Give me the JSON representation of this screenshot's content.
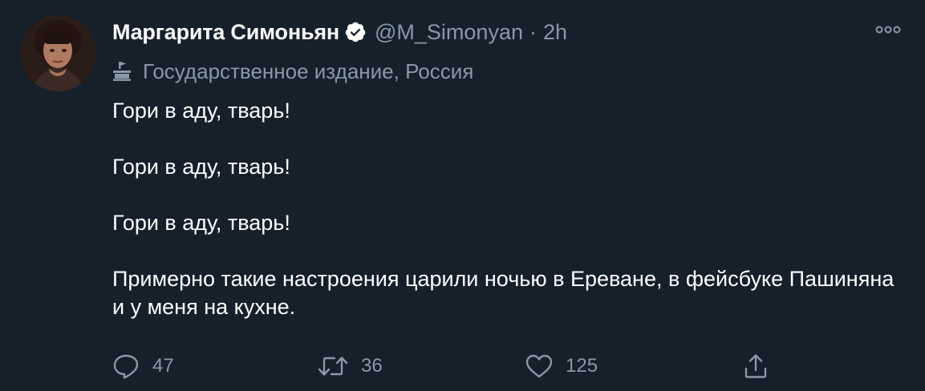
{
  "tweet": {
    "author_name": "Маргарита Симоньян",
    "handle": "@M_Simonyan",
    "separator": "·",
    "time": "2h",
    "state_media_label": "Государственное издание, Россия",
    "paragraphs": [
      "Гори в аду, тварь!",
      "Гори в аду, тварь!",
      "Гори в аду, тварь!",
      "Примерно такие настроения царили ночью в Ереване, в фейсбуке Пашиняна и у меня на кухне."
    ]
  },
  "actions": {
    "reply_count": "47",
    "retweet_count": "36",
    "like_count": "125"
  },
  "icons": {
    "verified": "verified-badge-icon",
    "more": "more-options-icon",
    "state_media": "government-building-icon",
    "reply": "reply-icon",
    "retweet": "retweet-icon",
    "like": "heart-icon",
    "share": "share-icon"
  },
  "colors": {
    "background": "#15202b",
    "primary_text": "#ffffff",
    "secondary_text": "#8899a6"
  }
}
